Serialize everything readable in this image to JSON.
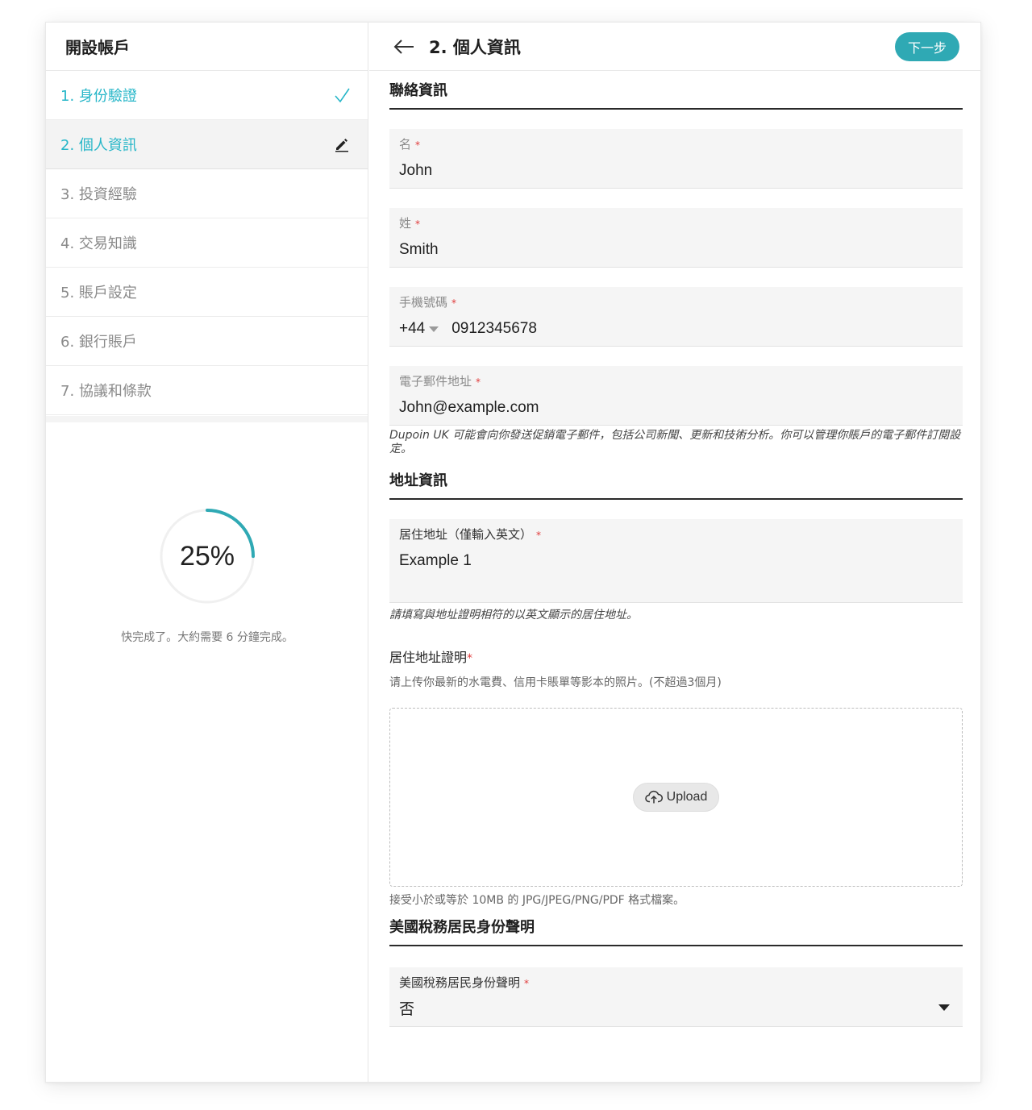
{
  "sidebar": {
    "title": "開設帳戶",
    "steps": [
      {
        "label": "1. 身份驗證",
        "state": "done",
        "icon": "check-icon"
      },
      {
        "label": "2. 個人資訊",
        "state": "active",
        "icon": "pencil-icon"
      },
      {
        "label": "3. 投資經驗",
        "state": "pending"
      },
      {
        "label": "4. 交易知識",
        "state": "pending"
      },
      {
        "label": "5. 賬戶設定",
        "state": "pending"
      },
      {
        "label": "6. 銀行賬戶",
        "state": "pending"
      },
      {
        "label": "7. 協議和條款",
        "state": "pending"
      }
    ],
    "progress": {
      "value": 0.25,
      "label": "25%",
      "note": "快完成了。大約需要 6 分鐘完成。"
    }
  },
  "header": {
    "title": "2. 個人資訊",
    "next_label": "下一步"
  },
  "contact": {
    "section_title": "聯絡資訊",
    "first_name": {
      "label": "名",
      "value": "John"
    },
    "last_name": {
      "label": "姓",
      "value": "Smith"
    },
    "phone": {
      "label": "手機號碼",
      "country_code": "+44",
      "number": "0912345678"
    },
    "email": {
      "label": "電子郵件地址",
      "value": "John@example.com"
    },
    "email_note": "Dupoin UK 可能會向你發送促銷電子郵件，包括公司新聞、更新和技術分析。你可以管理你賬戶的電子郵件訂閱設定。"
  },
  "address": {
    "section_title": "地址資訊",
    "residential": {
      "label": "居住地址（僅輸入英文）",
      "value": "Example 1"
    },
    "residential_note": "請填寫與地址證明相符的以英文顯示的居住地址。",
    "proof_label": "居住地址證明",
    "proof_help": "请上传你最新的水電費、信用卡賬單等影本的照片。(不超過3個月)",
    "upload_label": "Upload",
    "upload_note": "接受小於或等於 10MB 的 JPG/JPEG/PNG/PDF 格式檔案。"
  },
  "us_tax": {
    "section_title": "美國稅務居民身份聲明",
    "field_label": "美國稅務居民身份聲明",
    "value": "否"
  },
  "required_mark": "*",
  "colors": {
    "accent": "#26b6c8",
    "button": "#2fa9b4",
    "required": "#e03a3a"
  }
}
